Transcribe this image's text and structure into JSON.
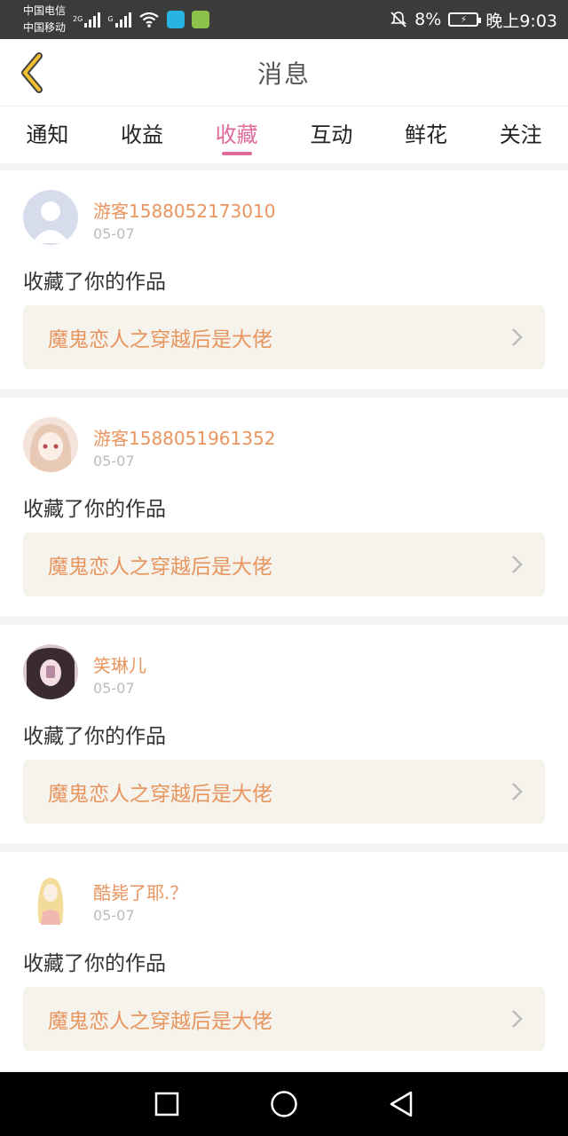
{
  "status_bar": {
    "carrier_1": "中国电信",
    "carrier_2": "中国移动",
    "net_type_1": "2G",
    "net_type_2": "G",
    "battery_percent": "8%",
    "time": "晚上9:03",
    "icons": [
      "signal-icon",
      "wifi-icon",
      "book-app-icon",
      "finance-app-icon",
      "silent-icon",
      "battery-icon"
    ]
  },
  "header": {
    "title": "消息"
  },
  "tabs": [
    {
      "label": "通知",
      "active": false
    },
    {
      "label": "收益",
      "active": false
    },
    {
      "label": "收藏",
      "active": true
    },
    {
      "label": "互动",
      "active": false
    },
    {
      "label": "鲜花",
      "active": false
    },
    {
      "label": "关注",
      "active": false
    }
  ],
  "messages": [
    {
      "user": "游客1588052173010",
      "date": "05-07",
      "action": "收藏了你的作品",
      "work_title": "魔鬼恋人之穿越后是大佬"
    },
    {
      "user": "游客1588051961352",
      "date": "05-07",
      "action": "收藏了你的作品",
      "work_title": "魔鬼恋人之穿越后是大佬"
    },
    {
      "user": "笑琳儿",
      "date": "05-07",
      "action": "收藏了你的作品",
      "work_title": "魔鬼恋人之穿越后是大佬"
    },
    {
      "user": "酷毙了耶.？",
      "date": "05-07",
      "action": "收藏了你的作品",
      "work_title": "魔鬼恋人之穿越后是大佬"
    }
  ],
  "colors": {
    "accent": "#e06b9a",
    "username": "#e8955f",
    "work_bg": "#f5f3ec",
    "back_arrow": "#f2c12e"
  }
}
